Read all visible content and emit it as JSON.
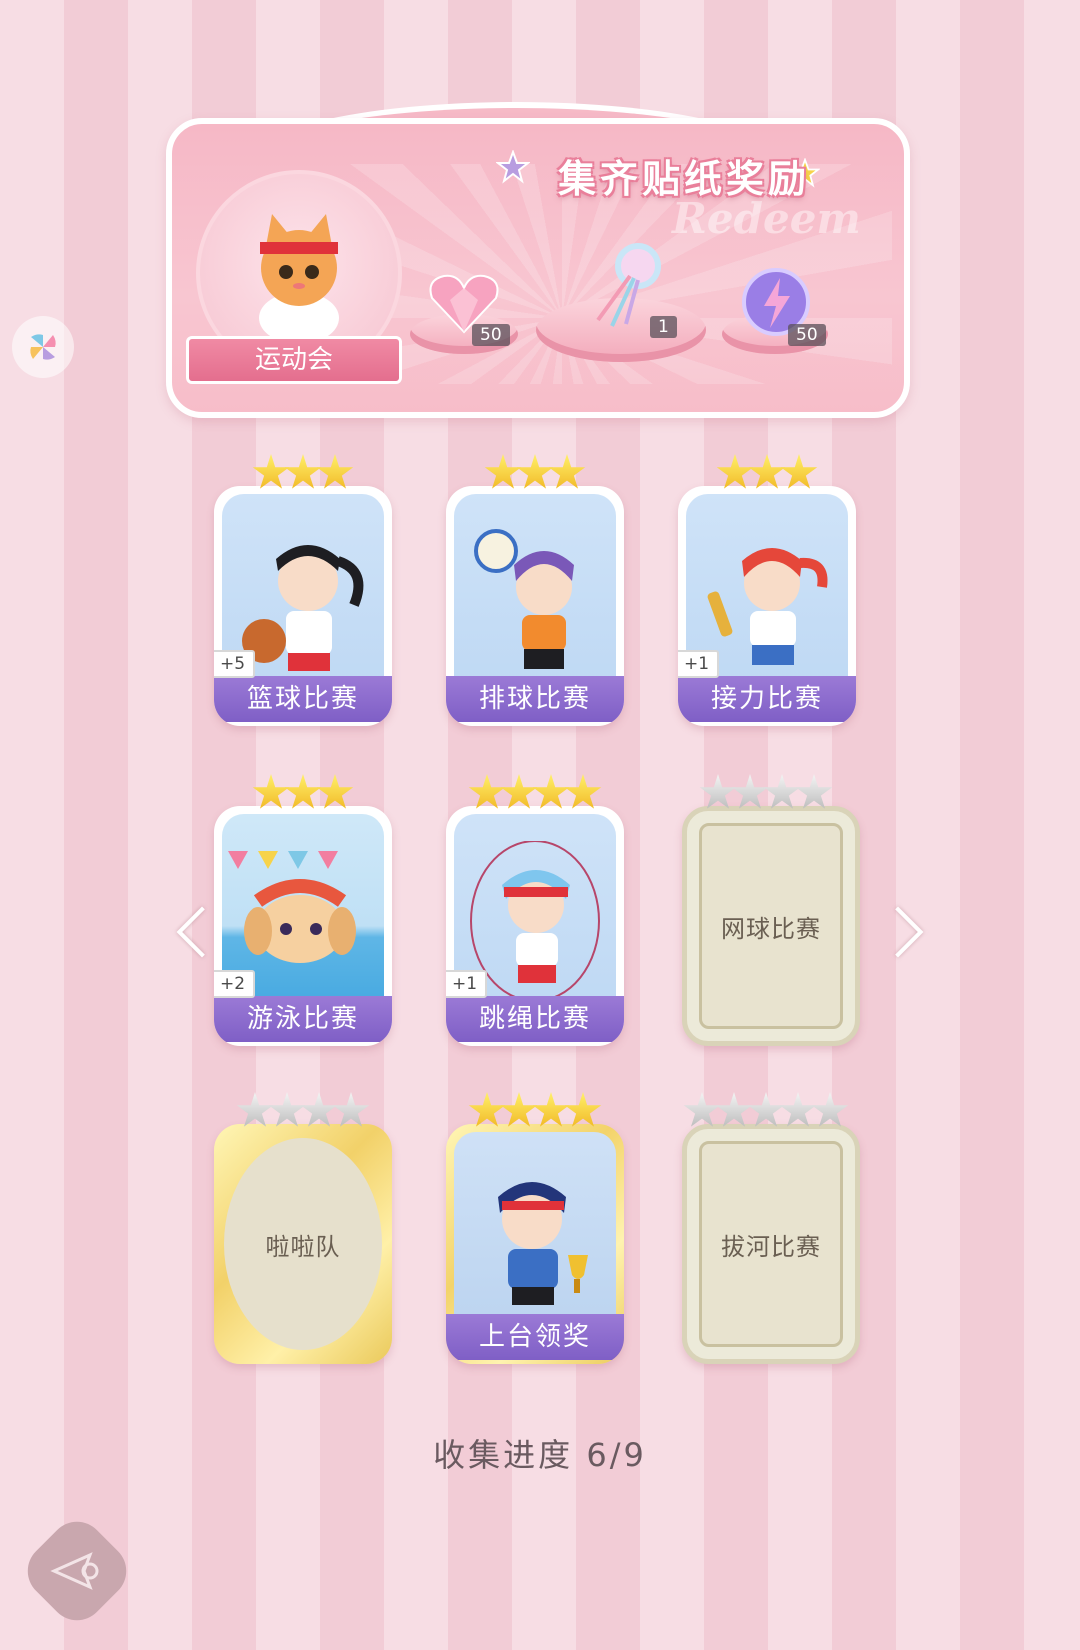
{
  "banner": {
    "title": "集齐贴纸奖励",
    "subtitle_deco": "Redeem",
    "event_name": "运动会",
    "rewards": [
      {
        "icon": "pink-heart-gem-icon",
        "qty": "50"
      },
      {
        "icon": "ribbon-bouquet-icon",
        "qty": "1"
      },
      {
        "icon": "lightning-orb-icon",
        "qty": "50"
      }
    ]
  },
  "cards": [
    {
      "label": "篮球比赛",
      "plus": "+5",
      "stars": 3,
      "state": "collected"
    },
    {
      "label": "排球比赛",
      "plus": "",
      "stars": 3,
      "state": "collected"
    },
    {
      "label": "接力比赛",
      "plus": "+1",
      "stars": 3,
      "state": "collected"
    },
    {
      "label": "游泳比赛",
      "plus": "+2",
      "stars": 3,
      "state": "collected"
    },
    {
      "label": "跳绳比赛",
      "plus": "+1",
      "stars": 4,
      "state": "collected"
    },
    {
      "label": "网球比赛",
      "plus": "",
      "stars": 4,
      "state": "locked"
    },
    {
      "label": "啦啦队",
      "plus": "",
      "stars": 4,
      "state": "locked-gold"
    },
    {
      "label": "上台领奖",
      "plus": "",
      "stars": 4,
      "state": "collected-gold"
    },
    {
      "label": "拔河比赛",
      "plus": "",
      "stars": 5,
      "state": "locked"
    }
  ],
  "progress": {
    "label": "收集进度",
    "value": "6/9"
  },
  "colors": {
    "accent_purple": "#8a6ad0",
    "banner_pink": "#f6b8c6",
    "star_gold": "#f5c62e"
  }
}
